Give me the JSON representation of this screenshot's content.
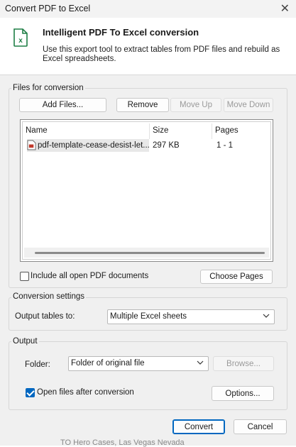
{
  "window": {
    "title": "Convert PDF to Excel",
    "close_glyph": "✕"
  },
  "header": {
    "title": "Intelligent PDF To Excel conversion",
    "description": "Use this export tool to extract tables from PDF files and rebuild as Excel spreadsheets.",
    "icon": "excel-file-icon",
    "accent": "#1e7e45"
  },
  "files": {
    "group_label": "Files for conversion",
    "buttons": {
      "add": "Add Files...",
      "remove": "Remove",
      "move_up": "Move Up",
      "move_down": "Move Down"
    },
    "columns": [
      "Name",
      "Size",
      "Pages"
    ],
    "rows": [
      {
        "name": "pdf-template-cease-desist-let...",
        "size": "297 KB",
        "pages": "1 - 1",
        "icon": "pdf-file-icon"
      }
    ],
    "include_all_label": "Include all open PDF documents",
    "include_all_checked": false,
    "choose_pages": "Choose Pages"
  },
  "conversion": {
    "group_label": "Conversion settings",
    "output_label": "Output tables to:",
    "output_value": "Multiple Excel sheets"
  },
  "output": {
    "group_label": "Output",
    "folder_label": "Folder:",
    "folder_value": "Folder of original file",
    "browse": "Browse...",
    "open_files_label": "Open files after conversion",
    "open_files_checked": true,
    "options": "Options..."
  },
  "actions": {
    "convert": "Convert",
    "cancel": "Cancel"
  },
  "background_text": "TO Hero Cases, Las Vegas Nevada",
  "colors": {
    "accent": "#0067c0",
    "pdf_red": "#c0392b"
  }
}
